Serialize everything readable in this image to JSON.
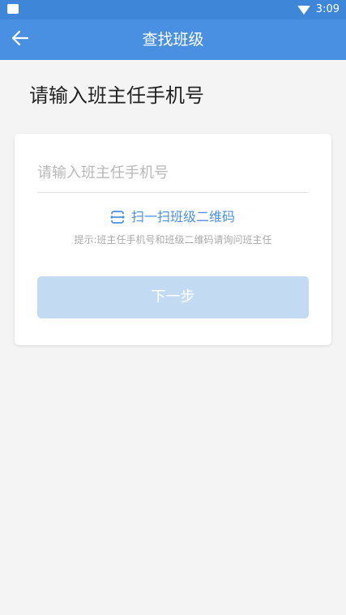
{
  "status_bar": {
    "time": "3:09"
  },
  "app_bar": {
    "title": "查找班级",
    "back_icon": "arrow-left-icon"
  },
  "main": {
    "heading": "请输入班主任手机号",
    "phone_input": {
      "value": "",
      "placeholder": "请输入班主任手机号"
    },
    "scan_link": {
      "icon": "scan-icon",
      "label": "扫一扫班级二维码"
    },
    "hint": "提示:班主任手机号和班级二维码请询问班主任",
    "next_button": {
      "label": "下一步"
    }
  },
  "colors": {
    "primary": "#4a90e2",
    "status_bar": "#3e86d8",
    "button_disabled": "#c3daf3",
    "background": "#f4f4f4"
  }
}
